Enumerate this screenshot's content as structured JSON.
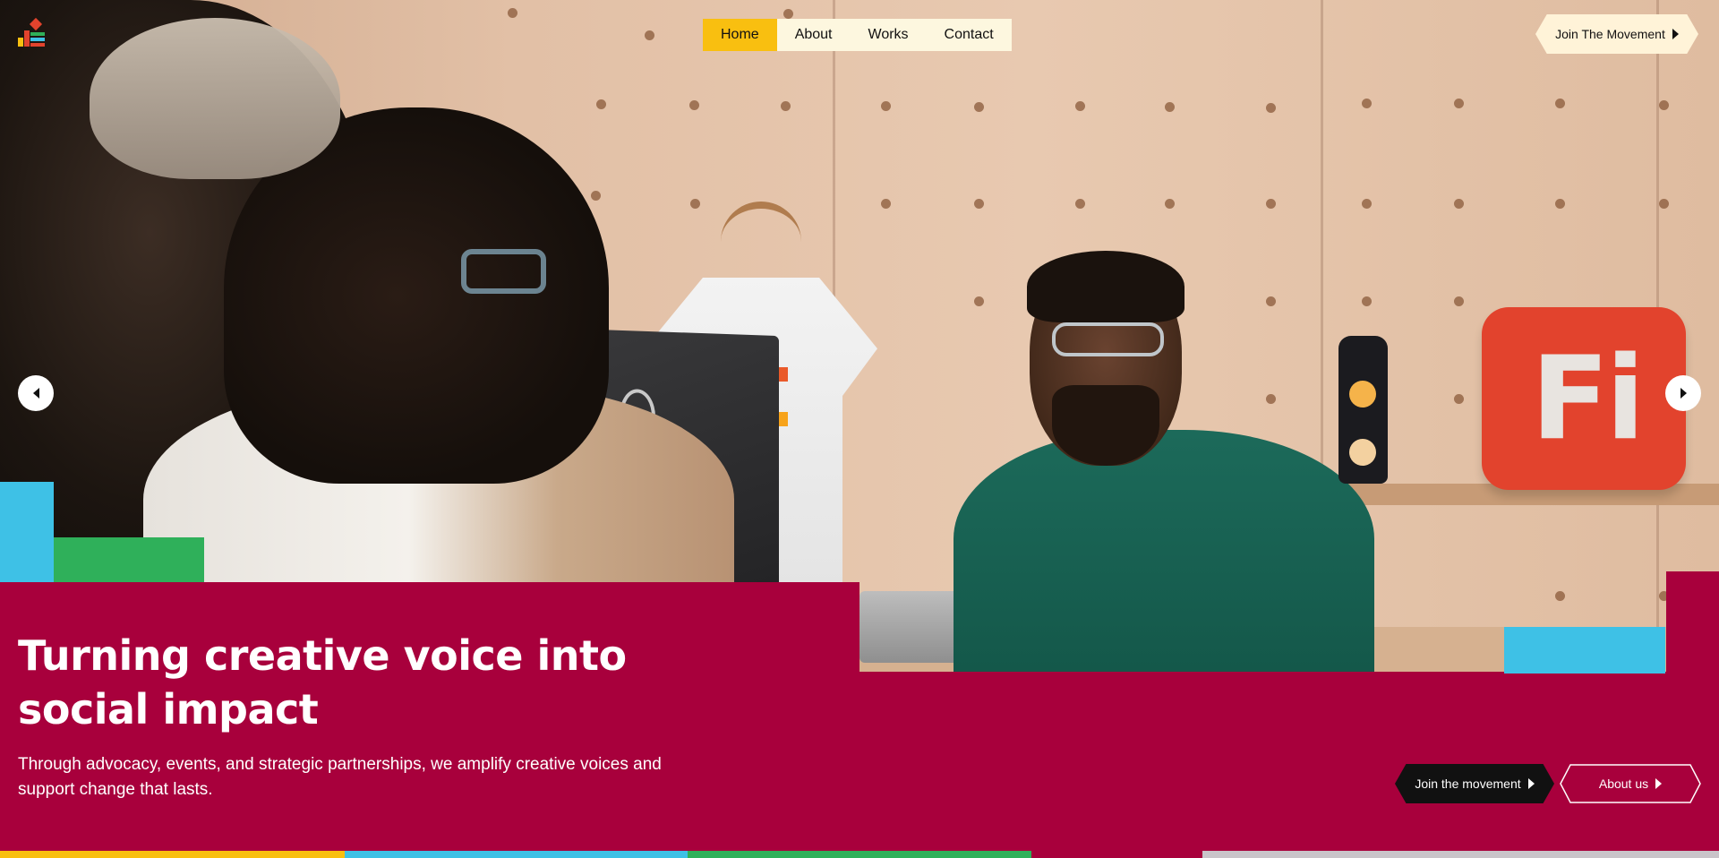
{
  "logo": {
    "name": "logo-icon"
  },
  "nav": {
    "items": [
      {
        "label": "Home",
        "active": true
      },
      {
        "label": "About",
        "active": false
      },
      {
        "label": "Works",
        "active": false
      },
      {
        "label": "Contact",
        "active": false
      }
    ]
  },
  "header": {
    "cta_label": "Join The Movement"
  },
  "carousel": {
    "prev_icon": "chevron-left-icon",
    "next_icon": "chevron-right-icon",
    "sign_text": "Fi"
  },
  "hero": {
    "title": "Turning creative voice into social impact",
    "subtitle": "Through advocacy, events, and strategic partnerships, we amplify creative voices and support change that lasts.",
    "primary_cta": "Join the movement",
    "secondary_cta": "About us"
  },
  "colors": {
    "crimson": "#a8003c",
    "yellow": "#f9bf10",
    "cyan": "#3ec1e6",
    "green": "#2fb05a",
    "nav_bg": "#fdf7df",
    "cta_bg": "#fff3d8"
  }
}
